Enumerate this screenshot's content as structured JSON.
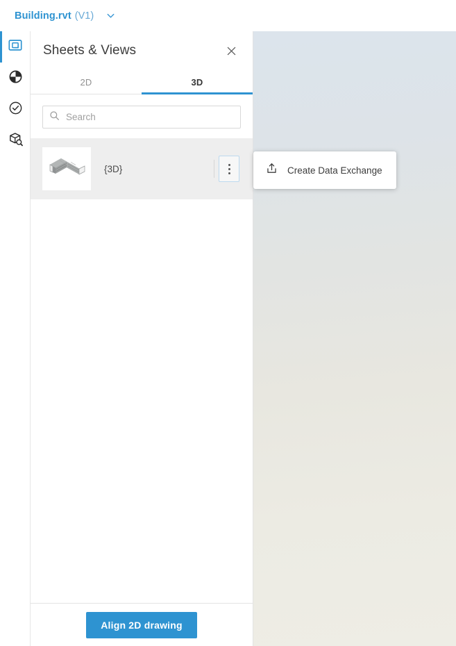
{
  "topbar": {
    "file_name": "Building.rvt",
    "version": "(V1)",
    "chevron_icon": "chevron-down-icon",
    "accent_color": "#2e93d1"
  },
  "sidebar": {
    "items": [
      {
        "name": "sheets-and-views",
        "icon": "sheet-views-icon",
        "active": true
      },
      {
        "name": "model-appearance",
        "icon": "contrast-circle-icon",
        "active": false
      },
      {
        "name": "issues",
        "icon": "check-circle-icon",
        "active": false
      },
      {
        "name": "model-browser",
        "icon": "cube-search-icon",
        "active": false
      }
    ]
  },
  "panel": {
    "title": "Sheets & Views",
    "close_icon": "close-icon",
    "tabs": [
      {
        "label": "2D",
        "active": false
      },
      {
        "label": "3D",
        "active": true
      }
    ],
    "search": {
      "placeholder": "Search",
      "value": "",
      "icon": "search-icon"
    },
    "views": [
      {
        "label": "{3D}",
        "thumbnail": "isometric-building-thumbnail",
        "menu_icon": "kebab-menu-icon",
        "selected": true
      }
    ],
    "footer": {
      "align_button_label": "Align 2D drawing",
      "align_button_color": "#2e93d1"
    }
  },
  "context_menu": {
    "items": [
      {
        "label": "Create Data Exchange",
        "icon": "upload-icon"
      }
    ]
  },
  "viewer": {
    "background_top_color": "#dce4ec",
    "background_bottom_color": "#eeede5"
  }
}
